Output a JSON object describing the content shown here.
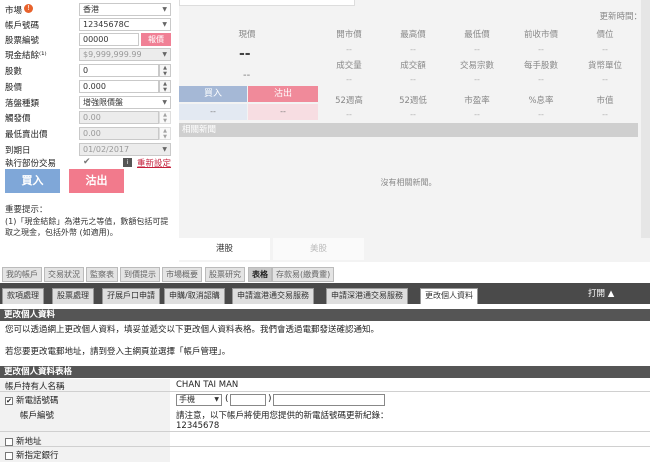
{
  "order_form": {
    "market_label": "市場",
    "market_info_icon": "!",
    "market_value": "香港",
    "account_label": "帳戶號碼",
    "account_value": "12345678C",
    "stock_code_label": "股票編號",
    "stock_code_value": "00000",
    "lot_button": "報價",
    "cash_balance_label": "現金結餘⁽¹⁾",
    "cash_balance_value": "$9,999,999.99",
    "lots_label": "股數",
    "lots_value": "0",
    "price_label": "股價",
    "price_value": "0.000",
    "order_type_label": "落盤種類",
    "order_type_value": "增強限價盤",
    "trigger_price_label": "觸發價",
    "trigger_price_value": "0.00",
    "min_sell_price_label": "最低賣出價",
    "min_sell_price_value": "0.00",
    "expiry_label": "到期日",
    "expiry_value": "01/02/2017",
    "exec_all_label": "執行部份交易",
    "exec_all_check": "✔",
    "rule_icon": "i",
    "reset_link": "重新設定",
    "buy_button": "買入",
    "sell_button": "沽出",
    "tips_title": "重要提示：",
    "tips_text": "(1)「現金結餘」為港元之等值，數額包括可提取之現金，包括外幣 (如適用)。"
  },
  "quote": {
    "update_time_label": "更新時間：",
    "headers_row1": [
      "現價",
      "開市價",
      "最高價",
      "最低價",
      "前收市價",
      "價位"
    ],
    "headers_row2": [
      "成交量",
      "成交額",
      "交易宗數",
      "每手股數",
      "貨幣單位"
    ],
    "headers_row3": [
      "52週高",
      "52週低",
      "市盈率",
      "%息率",
      "市值"
    ],
    "dash": "--",
    "big_dash": "--",
    "buy_header": "買入",
    "sell_header": "沽出",
    "news_header": "相關新聞",
    "news_empty": "沒有相關新聞。",
    "market_tab_hk": "港股",
    "market_tab_us": "美股"
  },
  "module_tabs": [
    "我的帳戶",
    "交易狀況",
    "監察表",
    "到價提示",
    "市場概要",
    "股票研究",
    "表格",
    "存款易(繳費靈)"
  ],
  "module_tab_active": "表格",
  "sub_tabs": [
    "款項處理",
    "股票處理",
    "孖展戶口申請",
    "申購/取消認購",
    "申請滬港通交易服務",
    "申請深港通交易服務",
    "更改個人資料"
  ],
  "sub_tab_active": "更改個人資料",
  "collapse_label": "打開 ▲",
  "section1": {
    "title": "更改個人資料",
    "line1": "您可以透過網上更改個人資料，填妥並遞交以下更改個人資料表格。我們會透過電郵發送確認通知。",
    "line2": "若您要更改電郵地址，請到登入主網頁並選擇「帳戶管理」。"
  },
  "section2": {
    "title": "更改個人資料表格",
    "holder_label": "帳戶持有人名稱",
    "holder_value": "CHAN TAI MAN",
    "new_phone_label": "新電話號碼",
    "new_phone_type": "手機",
    "account_no_label": "帳戶編號",
    "account_note": "請注意，以下帳戶將使用您提供的新電話號碼更新紀錄：",
    "account_no_value": "12345678",
    "new_address_label": "新地址",
    "new_bank_label": "新指定銀行"
  }
}
